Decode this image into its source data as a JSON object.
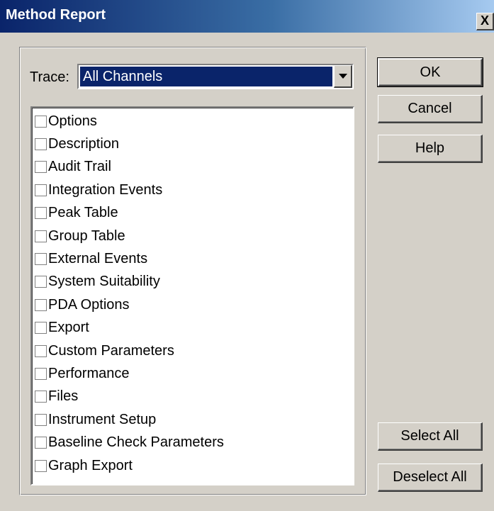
{
  "window": {
    "title": "Method Report",
    "close_label": "X"
  },
  "trace": {
    "label": "Trace:",
    "selected": "All Channels"
  },
  "items": [
    "Options",
    "Description",
    "Audit Trail",
    "Integration Events",
    "Peak Table",
    "Group Table",
    "External Events",
    "System Suitability",
    "PDA Options",
    "Export",
    "Custom Parameters",
    "Performance",
    "Files",
    "Instrument Setup",
    "Baseline Check Parameters",
    "Graph Export"
  ],
  "buttons": {
    "ok": "OK",
    "cancel": "Cancel",
    "help": "Help",
    "select_all": "Select All",
    "deselect_all": "Deselect All"
  }
}
